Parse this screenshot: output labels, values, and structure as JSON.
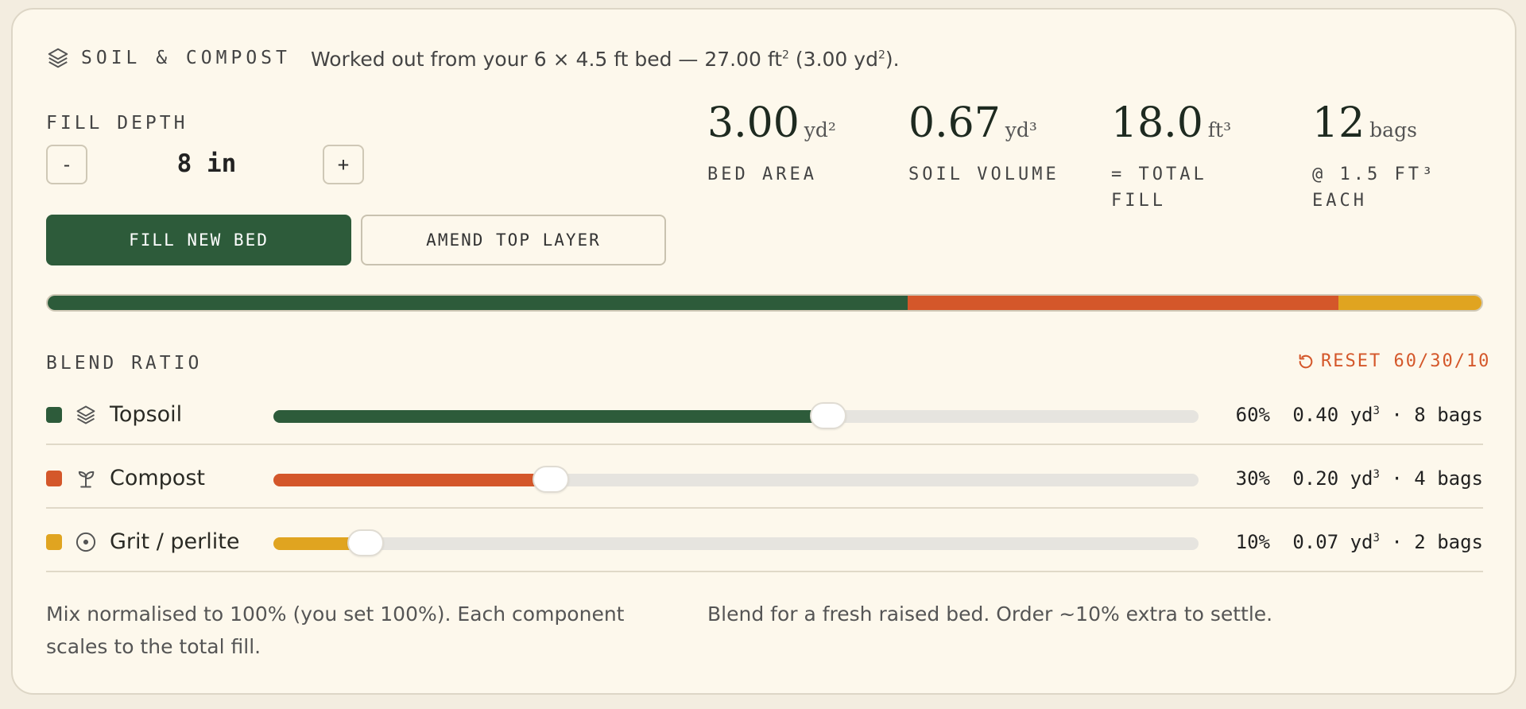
{
  "header": {
    "title": "SOIL & COMPOST",
    "desc_prefix": "Worked out from your 6 × 4.5 ft bed — 27.00 ft",
    "desc_sup1": "2",
    "desc_mid": " (3.00 yd",
    "desc_sup2": "2",
    "desc_suffix": ")."
  },
  "fill_depth": {
    "label": "FILL DEPTH",
    "minus": "-",
    "value": "8 in",
    "plus": "+"
  },
  "modes": {
    "new": "FILL NEW BED",
    "amend": "AMEND TOP LAYER",
    "active": "new"
  },
  "stats": [
    {
      "value": "3.00",
      "unit": "yd²",
      "label": "BED AREA"
    },
    {
      "value": "0.67",
      "unit": "yd³",
      "label": "SOIL VOLUME"
    },
    {
      "value": "18.0",
      "unit": "ft³",
      "label": "= TOTAL FILL"
    },
    {
      "value": "12",
      "unit": "bags",
      "label": "@ 1.5 FT³ EACH"
    }
  ],
  "blend": {
    "label": "BLEND RATIO",
    "reset": "RESET 60/30/10",
    "components": [
      {
        "name": "Topsoil",
        "icon": "layers-icon",
        "color": "#2d5b3a",
        "percent": 60,
        "pct_label": "60%",
        "qty_prefix": "0.40 yd",
        "qty_sup": "3",
        "qty_suffix": " · 8 bags"
      },
      {
        "name": "Compost",
        "icon": "sprout-icon",
        "color": "#d4572a",
        "percent": 30,
        "pct_label": "30%",
        "qty_prefix": "0.20 yd",
        "qty_sup": "3",
        "qty_suffix": " · 4 bags"
      },
      {
        "name": "Grit / perlite",
        "icon": "circle-dot-icon",
        "color": "#e0a420",
        "percent": 10,
        "pct_label": "10%",
        "qty_prefix": "0.07 yd",
        "qty_sup": "3",
        "qty_suffix": " · 2 bags"
      }
    ]
  },
  "notes": {
    "left": "Mix normalised to 100% (you set 100%). Each component scales to the total fill.",
    "right": "Blend for a fresh raised bed. Order ~10% extra to settle."
  }
}
